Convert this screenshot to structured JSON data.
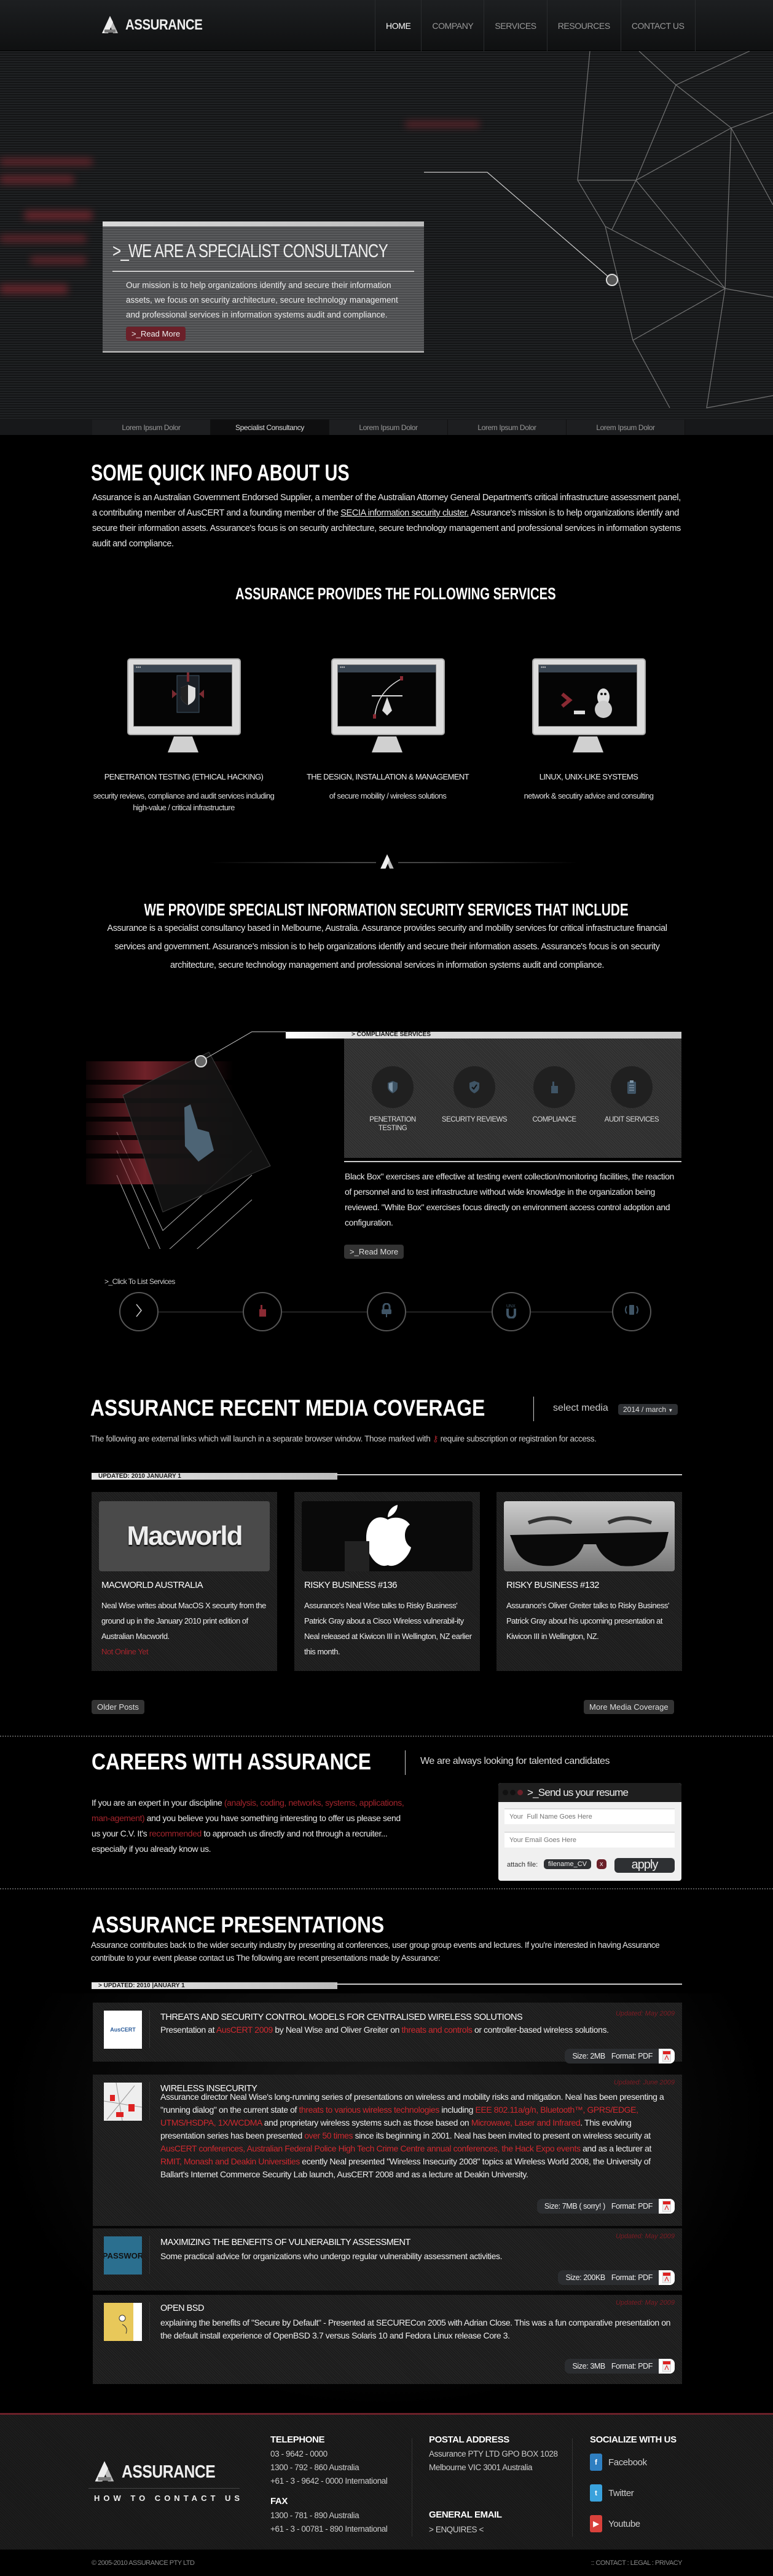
{
  "header": {
    "brand": "ASSURANCE",
    "nav": [
      {
        "label": "HOME",
        "active": true
      },
      {
        "label": "COMPANY"
      },
      {
        "label": "SERVICES"
      },
      {
        "label": "RESOURCES"
      },
      {
        "label": "CONTACT US"
      }
    ]
  },
  "hero": {
    "title": ">_WE ARE A SPECIALIST CONSULTANCY",
    "body": "Our mission is to help organizations identify and secure their information assets, we focus on security architecture, secure technology management and professional services in information systems audit and compliance.",
    "read_more": ">_Read More",
    "tabs": [
      {
        "label": "Lorem Ipsum Dolor"
      },
      {
        "label": "Specialist Consultancy",
        "active": true
      },
      {
        "label": "Lorem Ipsum Dolor"
      },
      {
        "label": "Lorem Ipsum Dolor"
      },
      {
        "label": "Lorem Ipsum Dolor"
      }
    ]
  },
  "about": {
    "title": "SOME QUICK INFO ABOUT US",
    "p_before": "Assurance is an Australian Government Endorsed Supplier, a member of the Australian Attorney General Department's critical infrastructure assessment panel, a contributing member of AusCERT and a founding member of the ",
    "link": "SECIA information security cluster.",
    "p_after": "  Assurance's mission is to help organizations identify and secure their  information assets. Assurance's focus is on security architecture, secure technology  management and professional services in  information systems audit and compliance."
  },
  "services": {
    "title": "ASSURANCE PROVIDES THE FOLLOWING SERVICES",
    "items": [
      {
        "title": "PENETRATION TESTING (ETHICAL HACKING)",
        "desc": "security reviews, compliance and audit services including high-value / critical infrastructure",
        "icon": "shield-document-icon"
      },
      {
        "title": "THE DESIGN, INSTALLATION & MANAGEMENT",
        "desc": "of secure mobility / wireless solutions",
        "icon": "pen-tool-icon"
      },
      {
        "title": "LINUX, UNIX-LIKE SYSTEMS",
        "desc": "network & secutiry advice and consulting",
        "icon": "terminal-penguin-icon"
      }
    ]
  },
  "specialist": {
    "title": "WE PROVIDE SPECIALIST INFORMATION SECURITY SERVICES THAT INCLUDE",
    "body": "Assurance is a specialist consultancy based in Melbourne, Australia. Assurance provides security and mobility services for critical infrastructure financial services and government. Assurance's mission is to help organizations identify and secure their information assets. Assurance's focus is on security architecture, secure technology management and professional services in information systems audit and compliance."
  },
  "compliance": {
    "header": "> COMPLIANCE SERVICES",
    "items": [
      {
        "label": "PENETRATION TESTING",
        "icon": "shield-icon"
      },
      {
        "label": "SECURITY REVIEWS",
        "icon": "shield-check-icon"
      },
      {
        "label": "COMPLIANCE",
        "icon": "thumbs-up-icon"
      },
      {
        "label": "AUDIT SERVICES",
        "icon": "clipboard-icon"
      }
    ],
    "body": "Black Box\" exercises are effective at testing event collection/monitoring facilities, the reaction of personnel and to test  infrastructure without wide knowledge in the organization being reviewed.  \"White Box\" exercises focus directly on environment access control adoption and configuration.",
    "read_more": ">_Read More",
    "list_label": ">_Click To List Services",
    "nav": [
      {
        "icon": "chevron-right-icon"
      },
      {
        "icon": "thumbs-up-icon",
        "active": true
      },
      {
        "icon": "network-lock-icon"
      },
      {
        "icon": "unix-icon"
      },
      {
        "icon": "mobile-signal-icon"
      }
    ]
  },
  "media": {
    "title": "ASSURANCE RECENT MEDIA COVERAGE",
    "select_label": "select media",
    "select_value": "2014 / march",
    "note_before": "The following are external links which will launch in a separate browser window. Those marked with",
    "note_after": "require subscription or registration for access.",
    "updated": "UPDATED: 2010 JANUARY 1",
    "cards": [
      {
        "title": "MACWORLD AUSTRALIA",
        "body": "Neal Wise writes about MacOS X security from the ground up in the January 2010 print edition of  Australian Macworld.",
        "status": "Not Online Yet",
        "image": "macworld",
        "image_text": "Macworld"
      },
      {
        "title": "RISKY BUSINESS #136",
        "body": "Assurance's Neal Wise talks to Risky Business' Patrick Gray about a Cisco Wireless vulnerabil-ity Neal released at Kiwicon III in Wellington, NZ earlier this month.",
        "image": "apple"
      },
      {
        "title": "RISKY BUSINESS #132",
        "body": "Assurance's Oliver Greiter talks to Risky Business' Patrick Gray about his upcoming presentation at Kiwicon III in Wellington, NZ.",
        "image": "sunglasses"
      }
    ],
    "older": "Older Posts",
    "more": "More Media Coverage"
  },
  "careers": {
    "title": "CAREERS WITH ASSURANCE",
    "tagline": "We are always looking for talented candidates",
    "para": [
      {
        "t": "If you are an expert in your discipline "
      },
      {
        "t": "(analysis, coding, networks, systems, applications, man-agement)",
        "hl": true
      },
      {
        "t": " and you believe you have something interesting to offer us please send us your C.V. It's "
      },
      {
        "t": "recommended",
        "hl": true
      },
      {
        "t": " to approach us directly and not through a recruiter... especially if you already know us."
      }
    ],
    "form": {
      "title": ">_Send us your resume",
      "name_placeholder": "Your  Full Name Goes Here",
      "email_placeholder": "Your Email Goes Here",
      "attach_label": "attach file:",
      "file": "filename_CV",
      "remove": "x",
      "apply": "apply"
    }
  },
  "presentations": {
    "title": "ASSURANCE PRESENTATIONS",
    "intro": "Assurance contributes back to the wider security industry by presenting at conferences, user group group events and lectures. If you're interested in having Assurance contribute to your event please contact us The following are recent presentations made by Assurance:",
    "updated": "> UPDATED: 2010 |ANUARY 1",
    "items": [
      {
        "title": "THREATS AND SECURITY CONTROL MODELS FOR CENTRALISED WIRELESS SOLUTIONS",
        "updated": "Updated: May 2009",
        "size": "Size: 2MB",
        "format": "Format: PDF",
        "thumb": "auscert",
        "thumb_text": "AusCERT",
        "desc": [
          {
            "t": "Presentation at "
          },
          {
            "t": "AusCERT 2009",
            "hl": true
          },
          {
            "t": " by Neal Wise and Oliver Greiter on "
          },
          {
            "t": "threats and controls",
            "hl": true
          },
          {
            "t": "  or controller-based wireless solutions."
          }
        ]
      },
      {
        "title": "WIRELESS INSECURITY",
        "updated": "Updated: June 2009",
        "size": "Size: 7MB ( sorry! )",
        "format": "Format: PDF",
        "thumb": "map",
        "desc": [
          {
            "t": "Assurance director Neal Wise's long-running series of presentations on wireless and mobility risks and mitigation. Neal has been presenting a \"running dialog\" on the current state of "
          },
          {
            "t": "threats to various wireless technologies",
            "hl": true
          },
          {
            "t": " including  "
          },
          {
            "t": "EEE 802.11a/g/n, Bluetooth™, GPRS/EDGE, UTMS/HSDPA, 1X/WCDMA",
            "hl": true
          },
          {
            "t": " and proprietary wireless systems such as those based on "
          },
          {
            "t": "Microwave, Laser and Infrared",
            "hl": true
          },
          {
            "t": ". This evolving presentation series has been presented "
          },
          {
            "t": "over 50 times",
            "hl": true
          },
          {
            "t": " since its  beginning in 2001. Neal has been invited to present on wireless security at "
          },
          {
            "t": "AusCERT conferences, Australian Federal Police High Tech Crime Centre annual conferences, the Hack Expo events",
            "hl": true
          },
          {
            "t": " and as a lecturer at "
          },
          {
            "t": "RMIT, Monash and Deakin Universities",
            "hl": true
          },
          {
            "t": " ecently Neal presented \"Wireless Insecurity 2008\" topics at Wireless World 2008, the University of Ballart's Internet Commerce Security Lab launch, AusCERT 2008 and as a lecture at Deakin University."
          }
        ]
      },
      {
        "title": "MAXIMIZING THE BENEFITS OF VULNERABILTY ASSESSMENT",
        "updated": "Updated: May 2009",
        "size": "Size: 200KB",
        "format": "Format: PDF",
        "thumb": "password",
        "thumb_text": "PASSWOR",
        "desc": [
          {
            "t": "Some practical advice for organizations who undergo regular vulnerability assessment activities."
          }
        ]
      },
      {
        "title": "OPEN BSD",
        "updated": "Updated: May 2009",
        "size": "Size: 3MB",
        "format": "Format: PDF",
        "thumb": "puffy",
        "desc": [
          {
            "t": "explaining the benefits of \"Secure by Default\" - Presented at SECURECon 2005 with Adrian Close. This was a fun comparative presentation on the default install experience of OpenBSD 3.7 versus Solaris 10 and Fedora Linux release Core 3."
          }
        ]
      }
    ]
  },
  "footer": {
    "brand": "ASSURANCE",
    "contact_label": "HOW TO CONTACT US",
    "telephone": {
      "title": "TELEPHONE",
      "lines": [
        "03 - 9642 - 0000",
        "1300 - 792 - 860   Australia",
        "+61 - 3 - 9642 - 0000 International"
      ]
    },
    "fax": {
      "title": "FAX",
      "lines": [
        "1300 - 781 - 890 Australia",
        "+61 - 3 - 00781 - 890 International"
      ]
    },
    "postal": {
      "title": "POSTAL ADDRESS",
      "lines": [
        "Assurance PTY LTD GPO BOX 1028",
        "Melbourne VIC 3001 Australia"
      ]
    },
    "email": {
      "title": "GENERAL EMAIL",
      "link": "> ENQUIRES <"
    },
    "social": {
      "title": "SOCIALIZE WITH US",
      "items": [
        {
          "label": "Facebook",
          "color": "#2f7fc1",
          "glyph": "f"
        },
        {
          "label": "Twitter",
          "color": "#3aa2dc",
          "glyph": "t"
        },
        {
          "label": "Youtube",
          "color": "#d8413b",
          "glyph": "▶"
        }
      ]
    },
    "copyright": "© 2005-2010 ASSURANCE PTY LTD",
    "links": ":: CONTACT : LEGAL : PRIVACY"
  },
  "colors": {
    "accent": "#6b2029",
    "highlight": "#d0292f"
  }
}
